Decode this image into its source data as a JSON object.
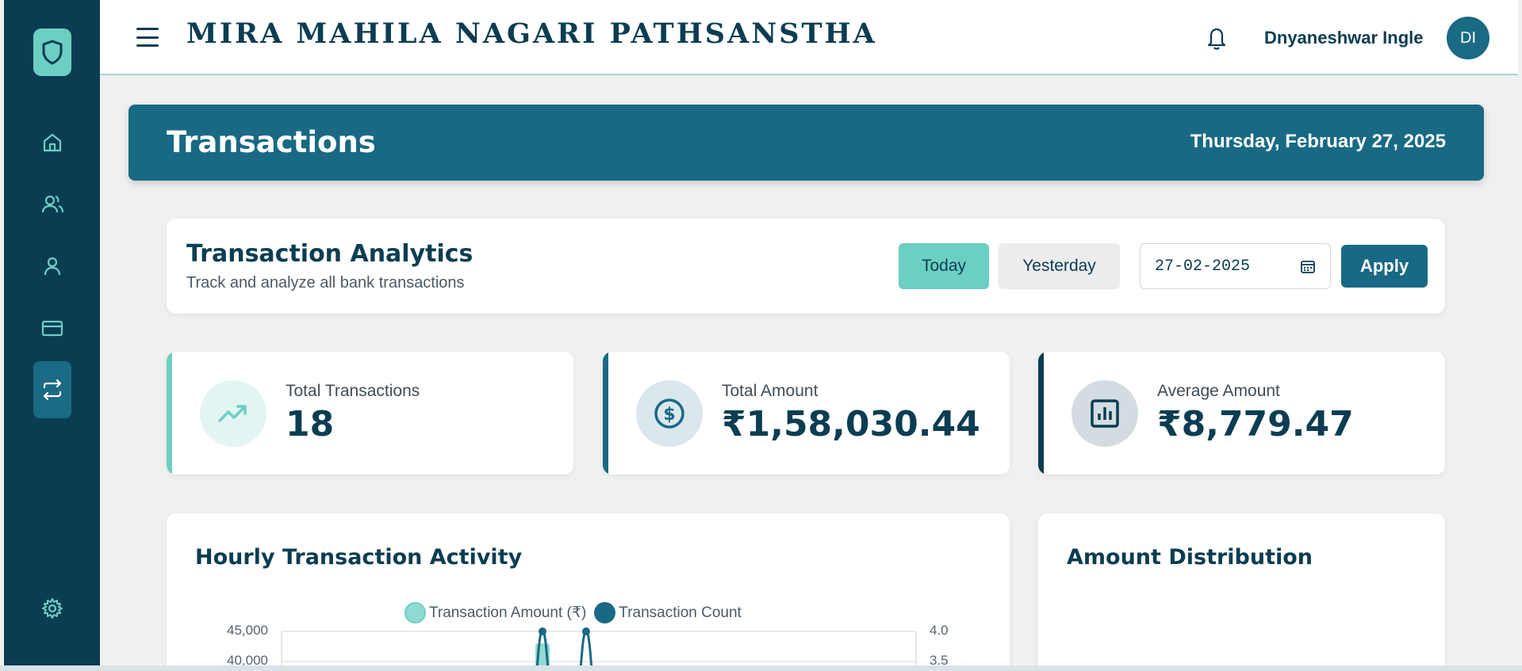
{
  "app": {
    "brand": "MIRA MAHILA NAGARI PATHSANSTHA",
    "user_name": "Dnyaneshwar Ingle",
    "user_initials": "DI"
  },
  "sidebar": {
    "items": [
      {
        "name": "home",
        "icon": "home-icon"
      },
      {
        "name": "members",
        "icon": "users-icon"
      },
      {
        "name": "profile",
        "icon": "user-icon"
      },
      {
        "name": "cards",
        "icon": "credit-card-icon"
      },
      {
        "name": "transactions",
        "icon": "transfer-icon",
        "active": true
      },
      {
        "name": "settings",
        "icon": "gear-icon"
      }
    ]
  },
  "page": {
    "title": "Transactions",
    "date": "Thursday, February 27, 2025"
  },
  "analytics": {
    "title": "Transaction Analytics",
    "subtitle": "Track and analyze all bank transactions",
    "today_label": "Today",
    "yesterday_label": "Yesterday",
    "date_value": "27-02-2025",
    "apply_label": "Apply"
  },
  "stats": {
    "total_transactions": {
      "label": "Total Transactions",
      "value": "18"
    },
    "total_amount": {
      "label": "Total Amount",
      "value": "₹1,58,030.44"
    },
    "average_amount": {
      "label": "Average Amount",
      "value": "₹8,779.47"
    }
  },
  "charts": {
    "hourly_title": "Hourly Transaction Activity",
    "distribution_title": "Amount Distribution"
  },
  "colors": {
    "sidebar": "#0b3d52",
    "accent": "#6ccfc3",
    "primary": "#196985"
  },
  "chart_data": {
    "type": "line",
    "title": "Hourly Transaction Activity",
    "series": [
      {
        "name": "Transaction Amount (₹)",
        "color": "#8fdad2"
      },
      {
        "name": "Transaction Count",
        "color": "#196985"
      }
    ],
    "y_left_ticks": [
      "45,000",
      "40,000"
    ],
    "y_right_ticks": [
      "4.0",
      "3.5"
    ],
    "ylim_left": [
      null,
      45000
    ],
    "ylim_right": [
      null,
      4.0
    ],
    "visible_peaks_right": [
      4.0,
      4.0
    ]
  }
}
